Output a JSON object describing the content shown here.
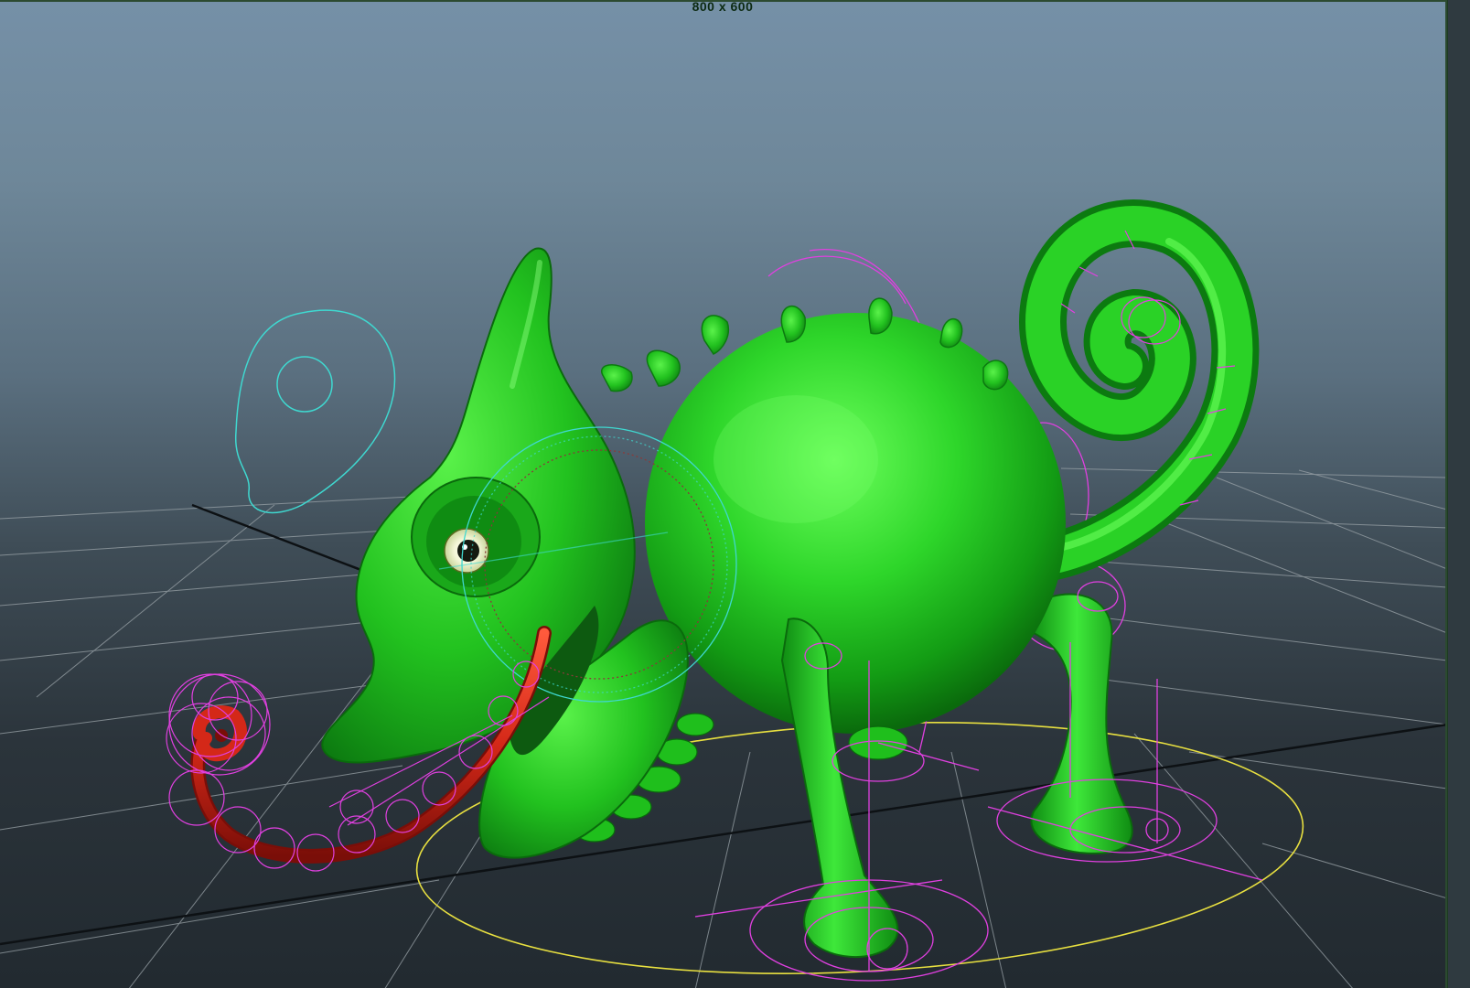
{
  "viewport": {
    "resolution_gate_label": "800 x 600"
  },
  "scene": {
    "character": "chameleon",
    "body_color": "#22d422",
    "tongue_color": "#d4281a",
    "control_colors": {
      "ik_handles": "#e040e0",
      "main_ctrl": "#e8e040",
      "eye_ctrl": "#3fd8d0",
      "grid": "#9aa3a8"
    }
  }
}
